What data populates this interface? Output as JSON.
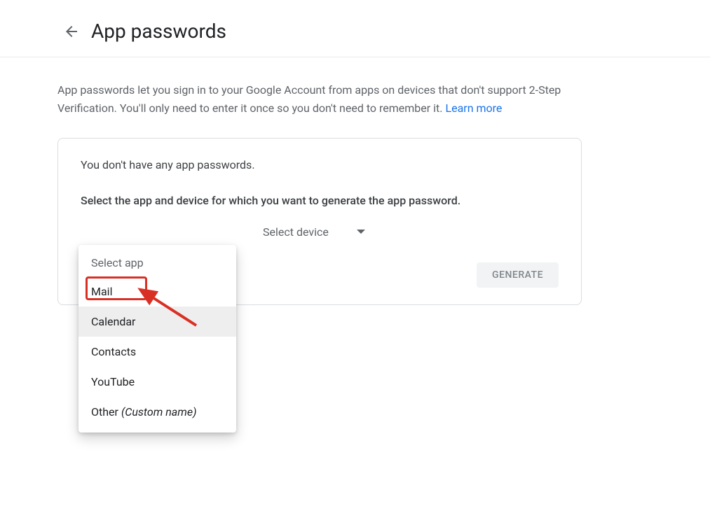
{
  "header": {
    "title": "App passwords"
  },
  "intro": {
    "text_part1": "App passwords let you sign in to your Google Account from apps on devices that don't support 2-Step Verification. You'll only need to enter it once so you don't need to remember it. ",
    "learn_more": "Learn more"
  },
  "card": {
    "no_passwords": "You don't have any app passwords.",
    "select_label": "Select the app and device for which you want to generate the app password.",
    "device_placeholder": "Select device",
    "generate_label": "GENERATE"
  },
  "app_dropdown": {
    "placeholder": "Select app",
    "options": [
      {
        "label": "Mail",
        "highlighted": true,
        "hovered": false
      },
      {
        "label": "Calendar",
        "highlighted": false,
        "hovered": true
      },
      {
        "label": "Contacts",
        "highlighted": false,
        "hovered": false
      },
      {
        "label": "YouTube",
        "highlighted": false,
        "hovered": false
      }
    ],
    "other_prefix": "Other ",
    "other_suffix": "(Custom name)"
  },
  "annotation": {
    "highlight_color": "#d93025"
  }
}
